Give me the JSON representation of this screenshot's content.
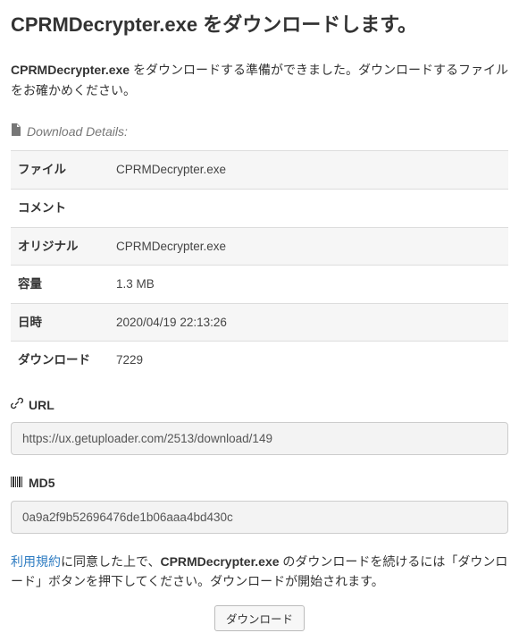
{
  "title": "CPRMDecrypter.exe をダウンロードします。",
  "intro": {
    "bold": "CPRMDecrypter.exe",
    "rest": " をダウンロードする準備ができました。ダウンロードするファイルをお確かめください。"
  },
  "details_heading": "Download Details:",
  "details": [
    {
      "label": "ファイル",
      "value": "CPRMDecrypter.exe"
    },
    {
      "label": "コメント",
      "value": ""
    },
    {
      "label": "オリジナル",
      "value": "CPRMDecrypter.exe"
    },
    {
      "label": "容量",
      "value": "1.3 MB"
    },
    {
      "label": "日時",
      "value": "2020/04/19 22:13:26"
    },
    {
      "label": "ダウンロード",
      "value": "7229"
    }
  ],
  "url_heading": "URL",
  "url_value": "https://ux.getuploader.com/2513/download/149",
  "md5_heading": "MD5",
  "md5_value": "0a9a2f9b52696476de1b06aaa4bd430c",
  "agree": {
    "terms_link": "利用規約",
    "part1": "に同意した上で、",
    "bold": "CPRMDecrypter.exe",
    "part2": " のダウンロードを続けるには「ダウンロード」ボタンを押下してください。ダウンロードが開始されます。"
  },
  "download_button": "ダウンロード"
}
